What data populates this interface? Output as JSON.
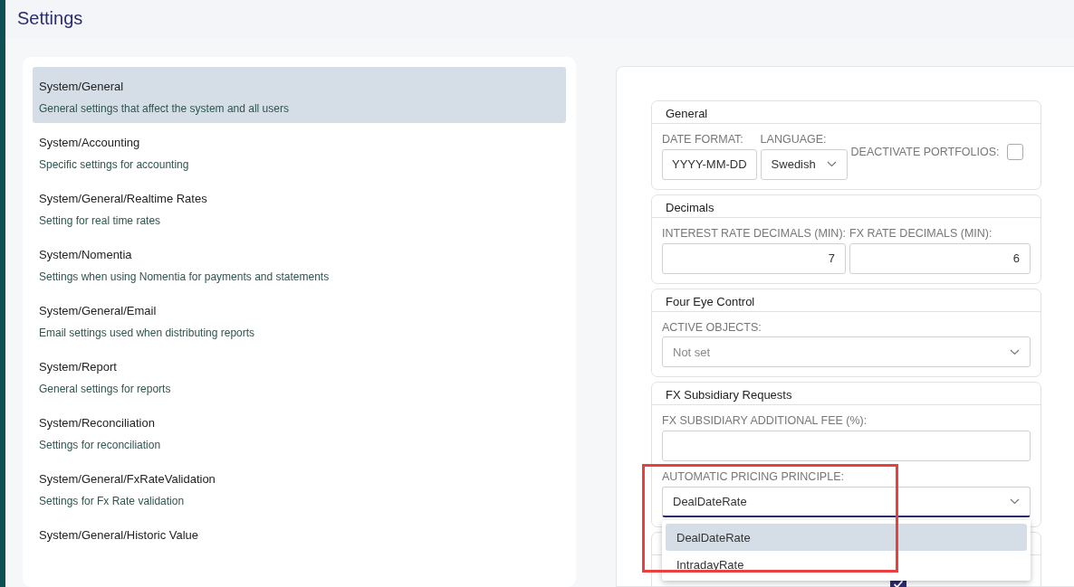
{
  "page_title": "Settings",
  "categories": [
    {
      "title": "System/General",
      "description": "General settings that affect the system and all users",
      "selected": true
    },
    {
      "title": "System/Accounting",
      "description": "Specific settings for accounting",
      "selected": false
    },
    {
      "title": "System/General/Realtime Rates",
      "description": "Setting for real time rates",
      "selected": false
    },
    {
      "title": "System/Nomentia",
      "description": "Settings when using Nomentia for payments and statements",
      "selected": false
    },
    {
      "title": "System/General/Email",
      "description": "Email settings used when distributing reports",
      "selected": false
    },
    {
      "title": "System/Report",
      "description": "General settings for reports",
      "selected": false
    },
    {
      "title": "System/Reconciliation",
      "description": "Settings for reconciliation",
      "selected": false
    },
    {
      "title": "System/General/FxRateValidation",
      "description": "Settings for Fx Rate validation",
      "selected": false
    },
    {
      "title": "System/General/Historic Value",
      "selected": false
    }
  ],
  "sections": [
    {
      "title": "General",
      "fields": [
        {
          "kind": "text",
          "label": "DATE FORMAT:",
          "value": "YYYY-MM-DD"
        },
        {
          "kind": "select",
          "label": "LANGUAGE:",
          "value": "Swedish"
        },
        {
          "kind": "checkbox",
          "label": "DEACTIVATE PORTFOLIOS:",
          "checked": false
        }
      ]
    },
    {
      "title": "Decimals",
      "fields": [
        {
          "kind": "number",
          "label": "INTEREST RATE DECIMALS (MIN):",
          "value": "7"
        },
        {
          "kind": "number",
          "label": "FX RATE DECIMALS (MIN):",
          "value": "6"
        }
      ]
    },
    {
      "title": "Four Eye Control",
      "fields": [
        {
          "kind": "select",
          "label": "ACTIVE OBJECTS:",
          "placeholder": "Not set"
        }
      ]
    },
    {
      "title": "FX Subsidiary Requests",
      "fields": [
        {
          "kind": "text",
          "label": "FX SUBSIDIARY ADDITIONAL FEE (%):"
        },
        {
          "kind": "select",
          "label": "AUTOMATIC PRICING PRINCIPLE:",
          "value": "DealDateRate",
          "expanded": true,
          "highlighted": true,
          "options": [
            {
              "label": "DealDateRate",
              "selected": true
            },
            {
              "label": "IntradayRate",
              "selected": false
            }
          ]
        }
      ]
    },
    {
      "fields": [
        {
          "kind": "checkbox",
          "checked": true
        }
      ]
    }
  ]
}
